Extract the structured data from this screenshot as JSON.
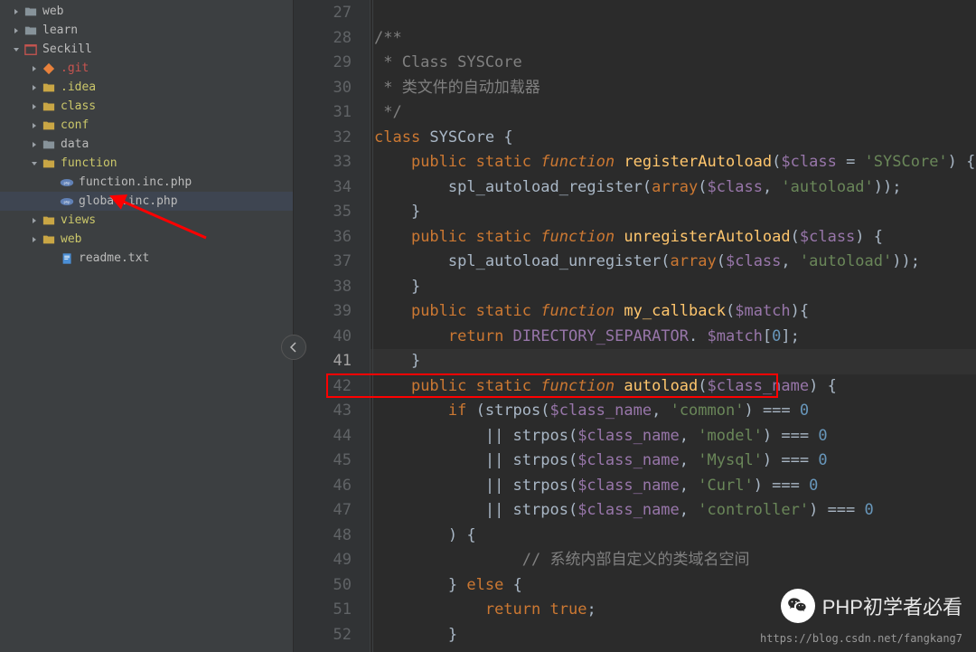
{
  "sidebar": {
    "items": [
      {
        "indent": 10,
        "arrow": "right",
        "icon": "folder-closed",
        "label": "web",
        "labelClass": "tree-label"
      },
      {
        "indent": 10,
        "arrow": "right",
        "icon": "folder-closed",
        "label": "learn",
        "labelClass": "tree-label"
      },
      {
        "indent": 10,
        "arrow": "down",
        "icon": "project-red",
        "label": "Seckill",
        "labelClass": "tree-root"
      },
      {
        "indent": 30,
        "arrow": "right",
        "icon": "git-orange",
        "label": ".git",
        "labelClass": "label-red"
      },
      {
        "indent": 30,
        "arrow": "right",
        "icon": "folder-open",
        "label": ".idea",
        "labelClass": "label-yellow"
      },
      {
        "indent": 30,
        "arrow": "right",
        "icon": "folder-open",
        "label": "class",
        "labelClass": "label-yellow"
      },
      {
        "indent": 30,
        "arrow": "right",
        "icon": "folder-open",
        "label": "conf",
        "labelClass": "label-yellow"
      },
      {
        "indent": 30,
        "arrow": "right",
        "icon": "folder-closed",
        "label": "data",
        "labelClass": "tree-label"
      },
      {
        "indent": 30,
        "arrow": "down",
        "icon": "folder-open",
        "label": "function",
        "labelClass": "label-yellow"
      },
      {
        "indent": 50,
        "arrow": "none",
        "icon": "php",
        "label": "function.inc.php",
        "labelClass": "tree-label"
      },
      {
        "indent": 50,
        "arrow": "none",
        "icon": "php",
        "label": "global.inc.php",
        "labelClass": "tree-label",
        "selected": true
      },
      {
        "indent": 30,
        "arrow": "right",
        "icon": "folder-open",
        "label": "views",
        "labelClass": "label-yellow"
      },
      {
        "indent": 30,
        "arrow": "right",
        "icon": "folder-open",
        "label": "web",
        "labelClass": "label-yellow"
      },
      {
        "indent": 50,
        "arrow": "none",
        "icon": "text-file",
        "label": "readme.txt",
        "labelClass": "tree-label"
      }
    ]
  },
  "editor": {
    "lines": [
      {
        "num": 27,
        "tokens": []
      },
      {
        "num": 28,
        "tokens": [
          {
            "t": "/**",
            "c": "c-comment"
          }
        ]
      },
      {
        "num": 29,
        "tokens": [
          {
            "t": " * Class SYSCore",
            "c": "c-comment"
          }
        ]
      },
      {
        "num": 30,
        "tokens": [
          {
            "t": " * 类文件的自动加载器",
            "c": "c-comment"
          }
        ]
      },
      {
        "num": 31,
        "tokens": [
          {
            "t": " */",
            "c": "c-comment"
          }
        ]
      },
      {
        "num": 32,
        "tokens": [
          {
            "t": "class ",
            "c": "c-keyword"
          },
          {
            "t": "SYSCore ",
            "c": "c-class-name"
          },
          {
            "t": "{",
            "c": "c-brace"
          }
        ]
      },
      {
        "num": 33,
        "indent": 4,
        "tokens": [
          {
            "t": "public ",
            "c": "c-keyword"
          },
          {
            "t": "static ",
            "c": "c-keyword"
          },
          {
            "t": "function ",
            "c": "c-func-keyword"
          },
          {
            "t": "registerAutoload",
            "c": "c-func-name"
          },
          {
            "t": "(",
            "c": "c-op"
          },
          {
            "t": "$class",
            "c": "c-var"
          },
          {
            "t": " = ",
            "c": "c-op"
          },
          {
            "t": "'SYSCore'",
            "c": "c-string"
          },
          {
            "t": ") {",
            "c": "c-brace"
          }
        ]
      },
      {
        "num": 34,
        "indent": 8,
        "tokens": [
          {
            "t": "spl_autoload_register",
            "c": "c-func-call"
          },
          {
            "t": "(",
            "c": "c-op"
          },
          {
            "t": "array",
            "c": "c-keyword"
          },
          {
            "t": "(",
            "c": "c-op"
          },
          {
            "t": "$class",
            "c": "c-var"
          },
          {
            "t": ", ",
            "c": "c-op"
          },
          {
            "t": "'autoload'",
            "c": "c-string"
          },
          {
            "t": "));",
            "c": "c-op"
          }
        ]
      },
      {
        "num": 35,
        "indent": 4,
        "tokens": [
          {
            "t": "}",
            "c": "c-brace"
          }
        ]
      },
      {
        "num": 36,
        "indent": 4,
        "tokens": [
          {
            "t": "public ",
            "c": "c-keyword"
          },
          {
            "t": "static ",
            "c": "c-keyword"
          },
          {
            "t": "function ",
            "c": "c-func-keyword"
          },
          {
            "t": "unregisterAutoload",
            "c": "c-func-name"
          },
          {
            "t": "(",
            "c": "c-op"
          },
          {
            "t": "$class",
            "c": "c-var"
          },
          {
            "t": ") {",
            "c": "c-brace"
          }
        ]
      },
      {
        "num": 37,
        "indent": 8,
        "tokens": [
          {
            "t": "spl_autoload_unregister",
            "c": "c-func-call"
          },
          {
            "t": "(",
            "c": "c-op"
          },
          {
            "t": "array",
            "c": "c-keyword"
          },
          {
            "t": "(",
            "c": "c-op"
          },
          {
            "t": "$class",
            "c": "c-var"
          },
          {
            "t": ", ",
            "c": "c-op"
          },
          {
            "t": "'autoload'",
            "c": "c-string"
          },
          {
            "t": "));",
            "c": "c-op"
          }
        ]
      },
      {
        "num": 38,
        "indent": 4,
        "tokens": [
          {
            "t": "}",
            "c": "c-brace"
          }
        ]
      },
      {
        "num": 39,
        "indent": 4,
        "tokens": [
          {
            "t": "public ",
            "c": "c-keyword"
          },
          {
            "t": "static ",
            "c": "c-keyword"
          },
          {
            "t": "function ",
            "c": "c-func-keyword"
          },
          {
            "t": "my_callback",
            "c": "c-func-name"
          },
          {
            "t": "(",
            "c": "c-op"
          },
          {
            "t": "$match",
            "c": "c-var"
          },
          {
            "t": "){",
            "c": "c-brace"
          }
        ]
      },
      {
        "num": 40,
        "indent": 8,
        "tokens": [
          {
            "t": "return ",
            "c": "c-keyword"
          },
          {
            "t": "DIRECTORY_SEPARATOR",
            "c": "c-const"
          },
          {
            "t": ". ",
            "c": "c-op"
          },
          {
            "t": "$match",
            "c": "c-var"
          },
          {
            "t": "[",
            "c": "c-op"
          },
          {
            "t": "0",
            "c": "c-number"
          },
          {
            "t": "];",
            "c": "c-op"
          }
        ]
      },
      {
        "num": 41,
        "indent": 4,
        "current": true,
        "tokens": [
          {
            "t": "}",
            "c": "c-brace"
          }
        ]
      },
      {
        "num": 42,
        "indent": 4,
        "highlighted": true,
        "tokens": [
          {
            "t": "public ",
            "c": "c-keyword"
          },
          {
            "t": "static ",
            "c": "c-keyword"
          },
          {
            "t": "function ",
            "c": "c-func-keyword"
          },
          {
            "t": "autoload",
            "c": "c-func-name"
          },
          {
            "t": "(",
            "c": "c-op"
          },
          {
            "t": "$class_name",
            "c": "c-var"
          },
          {
            "t": ") {",
            "c": "c-brace"
          }
        ]
      },
      {
        "num": 43,
        "indent": 8,
        "tokens": [
          {
            "t": "if ",
            "c": "c-keyword"
          },
          {
            "t": "(strpos(",
            "c": "c-op"
          },
          {
            "t": "$class_name",
            "c": "c-var"
          },
          {
            "t": ", ",
            "c": "c-op"
          },
          {
            "t": "'common'",
            "c": "c-string"
          },
          {
            "t": ") === ",
            "c": "c-op"
          },
          {
            "t": "0",
            "c": "c-number"
          }
        ]
      },
      {
        "num": 44,
        "indent": 12,
        "tokens": [
          {
            "t": "|| strpos(",
            "c": "c-op"
          },
          {
            "t": "$class_name",
            "c": "c-var"
          },
          {
            "t": ", ",
            "c": "c-op"
          },
          {
            "t": "'model'",
            "c": "c-string"
          },
          {
            "t": ") === ",
            "c": "c-op"
          },
          {
            "t": "0",
            "c": "c-number"
          }
        ]
      },
      {
        "num": 45,
        "indent": 12,
        "tokens": [
          {
            "t": "|| strpos(",
            "c": "c-op"
          },
          {
            "t": "$class_name",
            "c": "c-var"
          },
          {
            "t": ", ",
            "c": "c-op"
          },
          {
            "t": "'Mysql'",
            "c": "c-string"
          },
          {
            "t": ") === ",
            "c": "c-op"
          },
          {
            "t": "0",
            "c": "c-number"
          }
        ]
      },
      {
        "num": 46,
        "indent": 12,
        "tokens": [
          {
            "t": "|| strpos(",
            "c": "c-op"
          },
          {
            "t": "$class_name",
            "c": "c-var"
          },
          {
            "t": ", ",
            "c": "c-op"
          },
          {
            "t": "'Curl'",
            "c": "c-string"
          },
          {
            "t": ") === ",
            "c": "c-op"
          },
          {
            "t": "0",
            "c": "c-number"
          }
        ]
      },
      {
        "num": 47,
        "indent": 12,
        "tokens": [
          {
            "t": "|| strpos(",
            "c": "c-op"
          },
          {
            "t": "$class_name",
            "c": "c-var"
          },
          {
            "t": ", ",
            "c": "c-op"
          },
          {
            "t": "'controller'",
            "c": "c-string"
          },
          {
            "t": ") === ",
            "c": "c-op"
          },
          {
            "t": "0",
            "c": "c-number"
          }
        ]
      },
      {
        "num": 48,
        "indent": 8,
        "tokens": [
          {
            "t": ") {",
            "c": "c-brace"
          }
        ]
      },
      {
        "num": 49,
        "indent": 16,
        "tokens": [
          {
            "t": "// 系统内部自定义的类域名空间",
            "c": "c-line-comment"
          }
        ]
      },
      {
        "num": 50,
        "indent": 8,
        "tokens": [
          {
            "t": "} ",
            "c": "c-brace"
          },
          {
            "t": "else ",
            "c": "c-keyword"
          },
          {
            "t": "{",
            "c": "c-brace"
          }
        ]
      },
      {
        "num": 51,
        "indent": 12,
        "tokens": [
          {
            "t": "return ",
            "c": "c-keyword"
          },
          {
            "t": "true",
            "c": "c-keyword"
          },
          {
            "t": ";",
            "c": "c-op"
          }
        ]
      },
      {
        "num": 52,
        "indent": 8,
        "tokens": [
          {
            "t": "}",
            "c": "c-brace"
          }
        ]
      }
    ]
  },
  "watermark": "PHP初学者必看",
  "credit_url": "https://blog.csdn.net/fangkang7"
}
